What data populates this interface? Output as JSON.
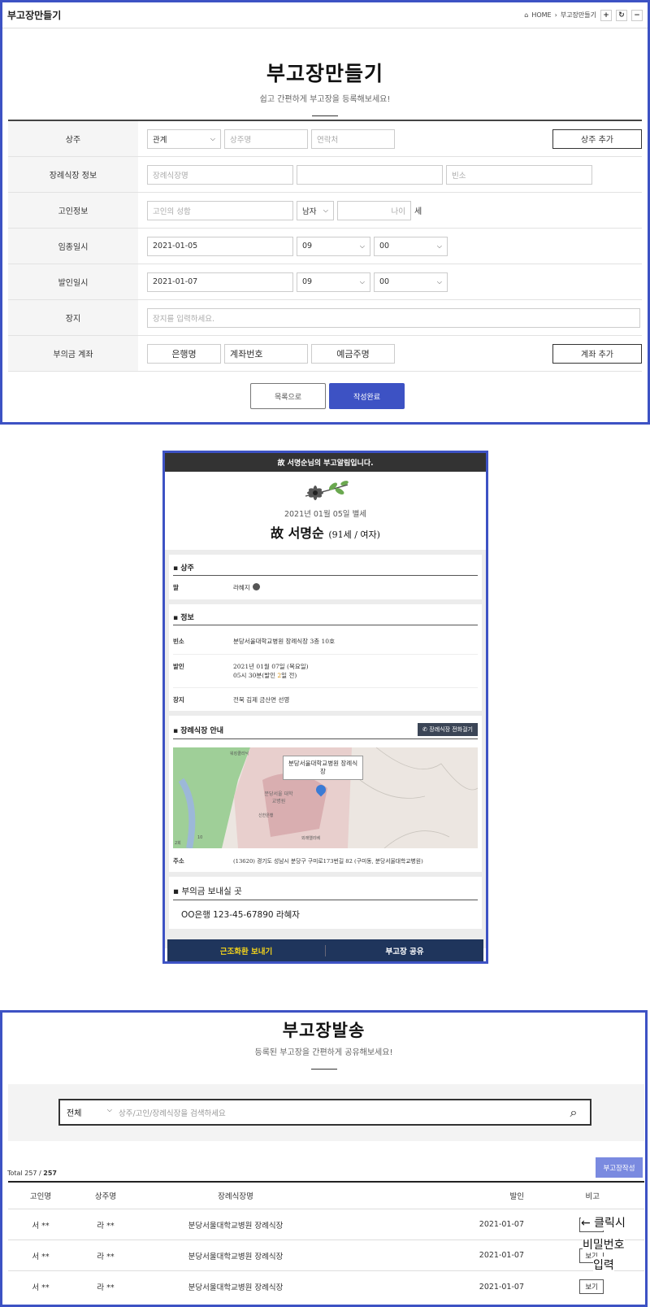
{
  "create": {
    "topbar_title": "부고장만들기",
    "breadcrumb_home": "HOME",
    "breadcrumb_sep": "›",
    "breadcrumb_current": "부고장만들기",
    "title": "부고장만들기",
    "subtitle": "쉽고 간편하게 부고장을 등록해보세요!",
    "rows": {
      "chief_mourner": {
        "label": "상주",
        "relation": "관계",
        "name_ph": "상주명",
        "contact_ph": "연락처",
        "add_btn": "상주 추가"
      },
      "funeral_hall": {
        "label": "장례식장 정보",
        "name_ph": "장례식장명",
        "second_ph": "",
        "room_ph": "빈소"
      },
      "deceased": {
        "label": "고인정보",
        "name_ph": "고인의 성함",
        "gender": "남자",
        "age_ph": "나이",
        "age_unit": "세"
      },
      "death_date": {
        "label": "임종일시",
        "date": "2021-01-05",
        "hour": "09",
        "minute": "00"
      },
      "burial_date": {
        "label": "발인일시",
        "date": "2021-01-07",
        "hour": "09",
        "minute": "00"
      },
      "burial_place": {
        "label": "장지",
        "placeholder": "장지를 입력하세요."
      },
      "account": {
        "label": "부의금 계좌",
        "bank": "은행명",
        "number": "계좌번호",
        "holder": "예금주명",
        "add_btn": "계좌 추가"
      }
    },
    "list_btn": "목록으로",
    "submit_btn": "작성완료"
  },
  "preview": {
    "header": "故 서명순님의 부고알림입니다.",
    "date": "2021년 01월 05일 별세",
    "name": "故 서명순",
    "age_gender": "(91세 / 여자)",
    "mourner_title": "상주",
    "mourner_rel": "딸",
    "mourner_name": "라혜지",
    "info_title": "정보",
    "room_key": "빈소",
    "room_val": "분당서울대학교병원 장례식장 3층 10호",
    "burial_key": "발인",
    "burial_val1": "2021년 01월 07일 (목요일)",
    "burial_val2_pre": "05시 30분(발인 ",
    "burial_val2_days": "2",
    "burial_val2_post": "일 전)",
    "place_key": "장지",
    "place_val": "전북 김제 금산면 선영",
    "hall_title": "장례식장 안내",
    "call_btn": "장례식장 전화걸기",
    "map_popup": "분당서울대학교병원 장례식 장",
    "map_label1": "워킹클리닉",
    "map_label2": "분당서울 대학교병원",
    "map_label3": "신한은행",
    "map_label4": "외래엘리베",
    "map_label5": "2회",
    "map_label6": "10",
    "addr_key": "주소",
    "addr_val": "(13620) 경기도 성남시 분당구 구미로173번길 82 (구미동, 분당서울대학교병원)",
    "donation_title": "부의금 보내실 곳",
    "donation_val": "OO은행 123-45-67890 라혜자",
    "wreath_btn": "근조화환 보내기",
    "share_btn": "부고장 공유"
  },
  "send": {
    "title": "부고장발송",
    "subtitle": "등록된 부고장을 간편하게 공유해보세요!",
    "filter": "전체",
    "search_ph": "상주/고인/장례식장을 검색하세요",
    "total_label": "Total 257 / ",
    "total_bold": "257",
    "new_btn": "부고장작성",
    "columns": [
      "고인명",
      "상주명",
      "장례식장명",
      "발인",
      "비고"
    ],
    "rows": [
      {
        "deceased": "서 **",
        "mourner": "라 **",
        "hall": "분당서울대학교병원 장례식장",
        "date": "2021-01-07",
        "action": "보기"
      },
      {
        "deceased": "서 **",
        "mourner": "라 **",
        "hall": "분당서울대학교병원 장례식장",
        "date": "2021-01-07",
        "action": "보기"
      },
      {
        "deceased": "서 **",
        "mourner": "라 **",
        "hall": "분당서울대학교병원 장례식장",
        "date": "2021-01-07",
        "action": "보기"
      }
    ],
    "note1": "← 클릭시",
    "note2": "비밀번호",
    "note3": "입력"
  },
  "colors": {
    "accent": "#3d52c4",
    "navy": "#1f355c",
    "dark": "#333333",
    "yellow": "#f2d21b"
  }
}
